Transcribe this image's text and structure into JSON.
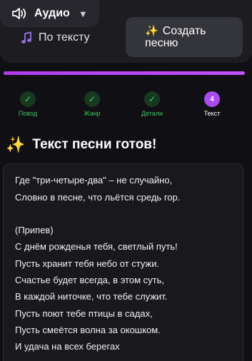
{
  "header": {
    "audio_label": "Аудио",
    "caret": "▼"
  },
  "mode_tabs": {
    "by_text": "По тексту",
    "create_song_line1": "Создать",
    "create_song_line2": "песню",
    "active": "create_song"
  },
  "progress": {
    "fraction": 1.0,
    "color": "#b53ff3"
  },
  "steps": [
    {
      "label": "Повод",
      "status": "done",
      "symbol": "✓"
    },
    {
      "label": "Жанр",
      "status": "done",
      "symbol": "✓"
    },
    {
      "label": "Детали",
      "status": "done",
      "symbol": "✓"
    },
    {
      "label": "Текст",
      "status": "active",
      "symbol": "4"
    }
  ],
  "result": {
    "title": "Текст песни готов!",
    "lyrics": [
      "Где \"три-четыре-два\" – не случайно,",
      "Словно в песне, что льётся средь гор.",
      "",
      "(Припев)",
      "С днём рожденья тебя, светлый путь!",
      "Пусть хранит тебя небо от стужи.",
      "Счастье будет всегда, в этом суть,",
      "В каждой ниточке, что тебе служит.",
      "Пусть поют тебе птицы в садах,",
      "Пусть смеётся волна за окошком.",
      "И удача на всех берегах"
    ]
  },
  "icons": {
    "speaker": "speaker-icon",
    "note": "music-note-icon",
    "sparkles": "sparkles-icon"
  },
  "colors": {
    "accent": "#a84cf2",
    "done": "#45d46d",
    "background": "#101014"
  }
}
